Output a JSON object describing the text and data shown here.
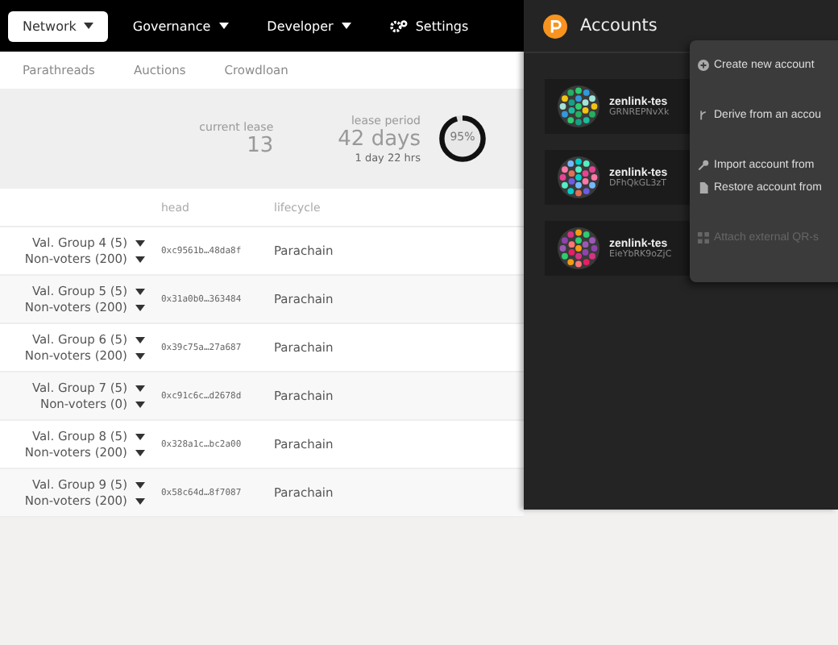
{
  "nav": {
    "tabs": [
      {
        "label": "Network",
        "selected": true,
        "dropdown": true
      },
      {
        "label": "Governance",
        "selected": false,
        "dropdown": true
      },
      {
        "label": "Developer",
        "selected": false,
        "dropdown": true
      },
      {
        "label": "Settings",
        "selected": false,
        "dropdown": false
      }
    ]
  },
  "subnav": [
    "Parathreads",
    "Auctions",
    "Crowdloan"
  ],
  "summary": {
    "current_lease": {
      "label": "current lease",
      "value": "13"
    },
    "lease_period": {
      "label": "lease period",
      "value": "42 days",
      "detail": "1 day 22 hrs",
      "gauge_label": "95%",
      "level": 0.95
    }
  },
  "table": {
    "columns": [
      "head",
      "lifecycle"
    ],
    "rows": [
      {
        "group": "Val. Group 4 (5)",
        "voters": "Non-voters (200)",
        "head": "0xc9561b…48da8f",
        "lifecycle": "Parachain"
      },
      {
        "group": "Val. Group 5 (5)",
        "voters": "Non-voters (200)",
        "head": "0x31a0b0…363484",
        "lifecycle": "Parachain"
      },
      {
        "group": "Val. Group 6 (5)",
        "voters": "Non-voters (200)",
        "head": "0x39c75a…27a687",
        "lifecycle": "Parachain"
      },
      {
        "group": "Val. Group 7 (5)",
        "voters": "Non-voters (0)",
        "head": "0xc91c6c…d2678d",
        "lifecycle": "Parachain"
      },
      {
        "group": "Val. Group 8 (5)",
        "voters": "Non-voters (200)",
        "head": "0x328a1c…bc2a00",
        "lifecycle": "Parachain"
      },
      {
        "group": "Val. Group 9 (5)",
        "voters": "Non-voters (200)",
        "head": "0x58c64d…8f7087",
        "lifecycle": "Parachain"
      }
    ]
  },
  "accounts_panel": {
    "title": "Accounts",
    "accounts": [
      {
        "name": "zenlink-tes",
        "address": "GRNREPNvXk"
      },
      {
        "name": "zenlink-tes",
        "address": "DFhQkGL3zT"
      },
      {
        "name": "zenlink-tes",
        "address": "EieYbRK9oZjC"
      }
    ],
    "menu": [
      {
        "label": "Create new account",
        "kind": "create",
        "disabled": false
      },
      {
        "label": "Derive from an accou",
        "kind": "derive",
        "disabled": false
      },
      {
        "label": "Import account from",
        "kind": "import",
        "disabled": false
      },
      {
        "label": "Restore account from",
        "kind": "restore",
        "disabled": false
      },
      {
        "label": "Attach external QR-s",
        "kind": "qr",
        "disabled": true
      }
    ]
  }
}
